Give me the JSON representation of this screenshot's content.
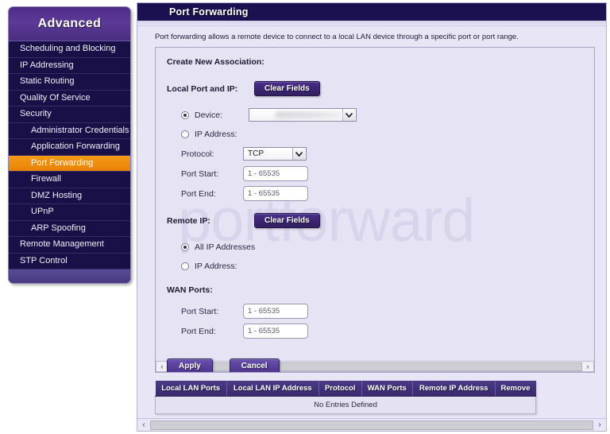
{
  "sidebar": {
    "header": "Advanced",
    "items": [
      {
        "label": "Scheduling and Blocking",
        "level": 0,
        "active": false
      },
      {
        "label": "IP Addressing",
        "level": 0,
        "active": false
      },
      {
        "label": "Static Routing",
        "level": 0,
        "active": false
      },
      {
        "label": "Quality Of Service",
        "level": 0,
        "active": false
      },
      {
        "label": "Security",
        "level": 0,
        "active": false
      },
      {
        "label": "Administrator Credentials",
        "level": 1,
        "active": false
      },
      {
        "label": "Application Forwarding",
        "level": 1,
        "active": false
      },
      {
        "label": "Port Forwarding",
        "level": 1,
        "active": true
      },
      {
        "label": "Firewall",
        "level": 1,
        "active": false
      },
      {
        "label": "DMZ Hosting",
        "level": 1,
        "active": false
      },
      {
        "label": "UPnP",
        "level": 1,
        "active": false
      },
      {
        "label": "ARP Spoofing",
        "level": 1,
        "active": false
      },
      {
        "label": "Remote Management",
        "level": 0,
        "active": false
      },
      {
        "label": "STP Control",
        "level": 0,
        "active": false
      }
    ]
  },
  "page": {
    "title": "Port Forwarding",
    "intro": "Port forwarding allows a remote device to connect to a local LAN device through a specific port or port range.",
    "watermark": "portforward"
  },
  "form": {
    "section_title": "Create New Association:",
    "local": {
      "group_label": "Local Port and IP:",
      "clear_label": "Clear Fields",
      "device_radio_label": "Device:",
      "device_selected": "",
      "ip_radio_label": "IP Address:",
      "protocol_label": "Protocol:",
      "protocol_value": "TCP",
      "port_start_label": "Port Start:",
      "port_start_value": "1 - 65535",
      "port_end_label": "Port End:",
      "port_end_value": "1 - 65535"
    },
    "remote": {
      "group_label": "Remote IP:",
      "clear_label": "Clear Fields",
      "all_ip_label": "All IP Addresses",
      "ip_address_label": "IP Address:"
    },
    "wan": {
      "group_label": "WAN Ports:",
      "port_start_label": "Port Start:",
      "port_start_value": "1 - 65535",
      "port_end_label": "Port End:",
      "port_end_value": "1 - 65535"
    },
    "apply_label": "Apply",
    "cancel_label": "Cancel"
  },
  "table": {
    "headers": [
      "Local LAN Ports",
      "Local LAN IP Address",
      "Protocol",
      "WAN Ports",
      "Remote IP Address",
      "Remove"
    ],
    "empty_message": "No Entries Defined"
  },
  "scroll": {
    "left_arrow": "‹",
    "right_arrow": "›"
  }
}
